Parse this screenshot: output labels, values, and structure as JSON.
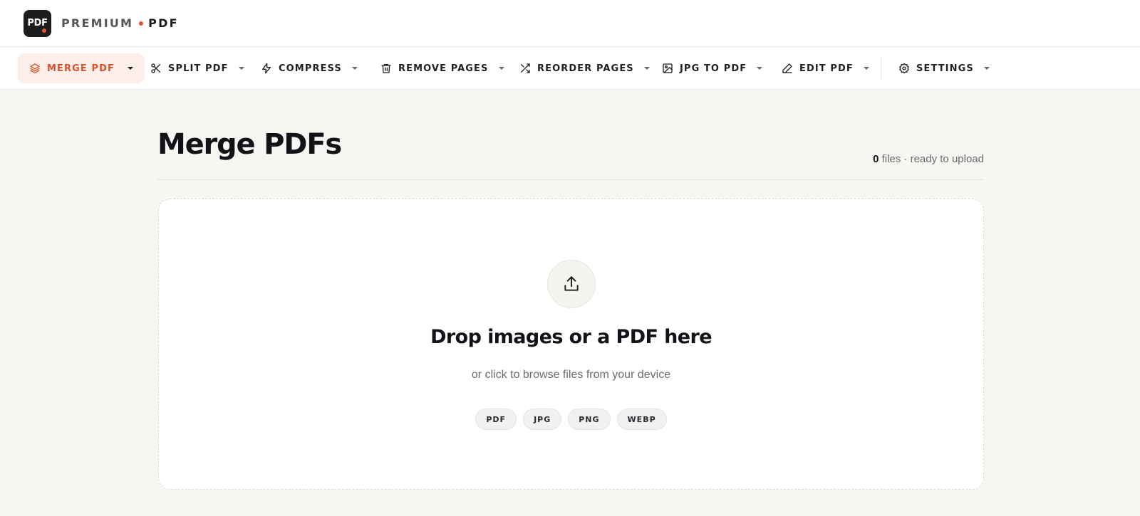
{
  "brand": {
    "logo_text": "PDF",
    "name_part1": "PREMIUM",
    "name_part2": "PDF",
    "accent_color": "#e2532f"
  },
  "nav": {
    "items": [
      {
        "label": "MERGE PDF",
        "icon": "layers-icon",
        "active": true
      },
      {
        "label": "SPLIT PDF",
        "icon": "scissors-icon",
        "active": false
      },
      {
        "label": "COMPRESS",
        "icon": "lightning-icon",
        "active": false
      },
      {
        "label": "REMOVE PAGES",
        "icon": "trash-icon",
        "active": false
      },
      {
        "label": "REORDER PAGES",
        "icon": "shuffle-icon",
        "active": false
      },
      {
        "label": "JPG TO PDF",
        "icon": "image-icon",
        "active": false
      },
      {
        "label": "EDIT PDF",
        "icon": "pencil-icon",
        "active": false
      },
      {
        "label": "SETTINGS",
        "icon": "gear-icon",
        "active": false
      }
    ]
  },
  "main": {
    "title": "Merge PDFs",
    "file_count": "0",
    "file_status_suffix": " files · ready to upload"
  },
  "dropzone": {
    "icon": "upload-icon",
    "title": "Drop images or a PDF here",
    "subtitle": "or click to browse files from your device",
    "formats": [
      "PDF",
      "JPG",
      "PNG",
      "WEBP"
    ]
  }
}
